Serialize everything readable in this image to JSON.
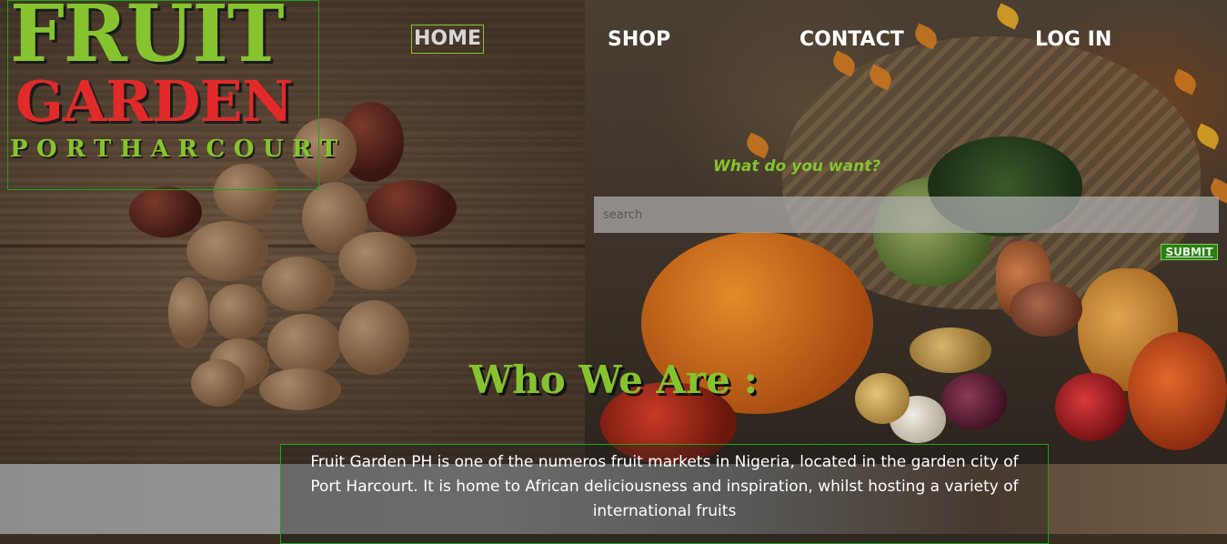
{
  "logo": {
    "line1": "FRUIT",
    "line2": "GARDEN",
    "line3": "PORTHARCOURT"
  },
  "nav": {
    "home": "HOME",
    "shop": "SHOP",
    "contact": "CONTACT",
    "login": "LOG IN",
    "active": "HOME"
  },
  "search": {
    "prompt": "What do you want?",
    "placeholder": "search",
    "submit_label": "SUBMIT"
  },
  "about": {
    "heading": "Who We Are :",
    "body": "Fruit Garden PH is one of the numeros fruit markets in Nigeria, located in the garden city of Port Harcourt. It is home to African deliciousness and inspiration, whilst hosting a variety of international fruits"
  },
  "colors": {
    "brand_green": "#86c42f",
    "brand_red": "#e12a2a",
    "border_green": "#1aa31a",
    "submit_bg": "#2a7d18"
  }
}
